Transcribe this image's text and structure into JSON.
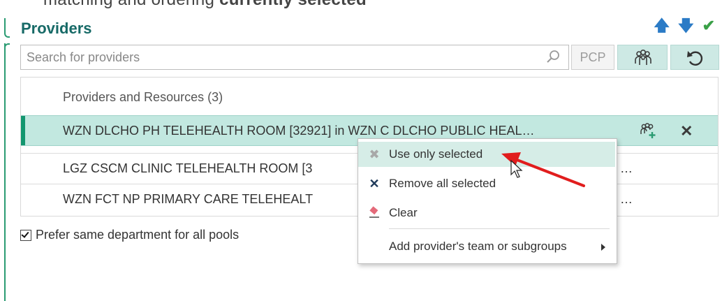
{
  "header": {
    "top_cut_text": "matching and ordering",
    "top_cut_bold": "currently selected",
    "title": "Providers",
    "icons": [
      "arrow-up-icon",
      "arrow-down-icon",
      "check-icon"
    ]
  },
  "search": {
    "placeholder": "Search for providers",
    "value": ""
  },
  "buttons": {
    "pcp_label": "PCP"
  },
  "list": {
    "header": "Providers and Resources (3)",
    "rows": [
      {
        "text": "WZN DLCHO PH TELEHEALTH ROOM [32921] in WZN C DLCHO PUBLIC HEAL…",
        "selected": true
      },
      {
        "text": "LGZ CSCM CLINIC TELEHEALTH ROOM [3",
        "trail": "…",
        "selected": false
      },
      {
        "text": "WZN FCT NP PRIMARY CARE TELEHEALT",
        "trail": "…",
        "selected": false
      }
    ]
  },
  "prefer": {
    "label": "Prefer same department for all pools",
    "checked": true
  },
  "context_menu": {
    "items": [
      {
        "label": "Use only selected",
        "icon": "faded-x-icon",
        "highlighted": true
      },
      {
        "label": "Remove all selected",
        "icon": "x-icon"
      },
      {
        "label": "Clear",
        "icon": "eraser-icon"
      },
      {
        "label": "Add provider's team or subgroups",
        "icon": "",
        "submenu": true
      }
    ]
  },
  "colors": {
    "accent": "#13966f",
    "selected_row": "#c2e8e0",
    "title": "#176a67",
    "arrow": "#e11d1d"
  }
}
